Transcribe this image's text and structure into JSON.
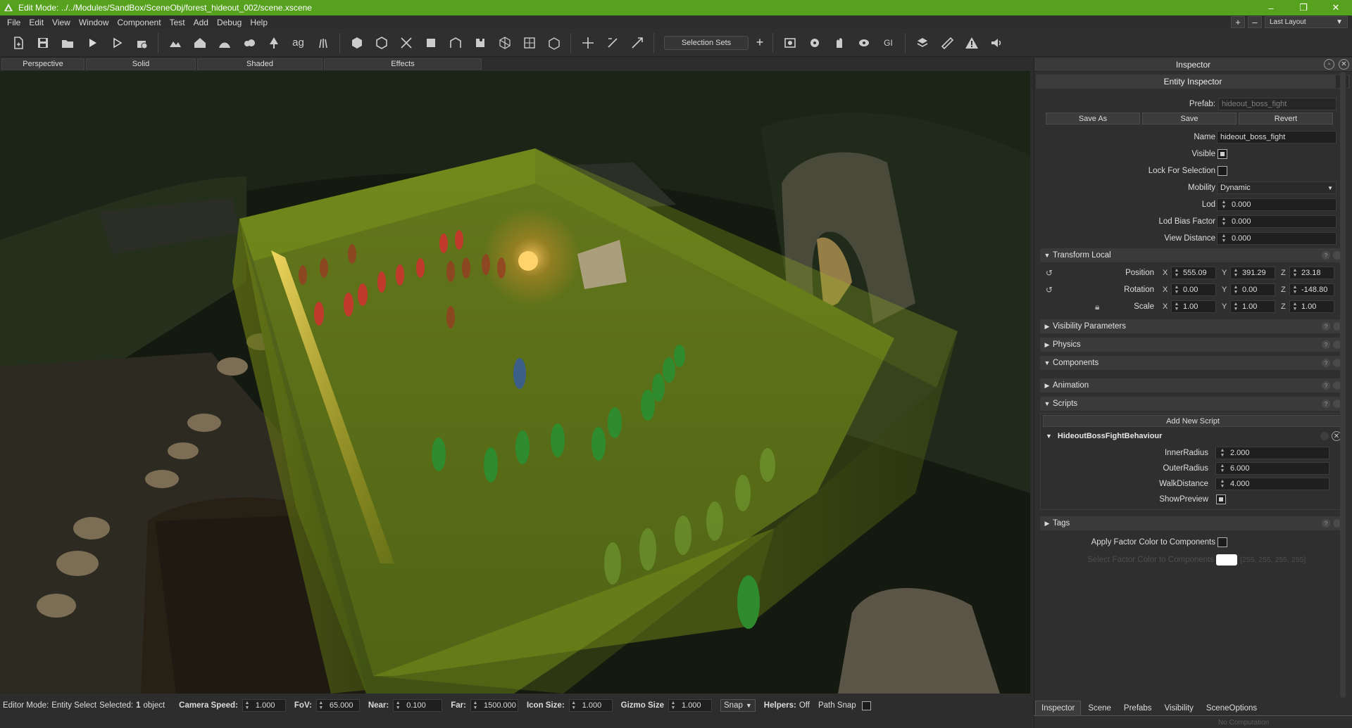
{
  "window": {
    "title": "Edit Mode: ../../Modules/SandBox/SceneObj/forest_hideout_002/scene.xscene",
    "minimize": "–",
    "maximize": "❐",
    "close": "✕"
  },
  "menu": [
    "File",
    "Edit",
    "View",
    "Window",
    "Component",
    "Test",
    "Add",
    "Debug",
    "Help"
  ],
  "layout": {
    "plus": "+",
    "minus": "–",
    "name": "Last Layout"
  },
  "toolbar": {
    "selection_sets": "Selection Sets",
    "add": "+"
  },
  "view_tabs": [
    "Perspective",
    "Solid",
    "Shaded",
    "Effects"
  ],
  "status": {
    "mode_label": "Editor Mode:",
    "mode_value": "Entity Select",
    "selected_label": "Selected:",
    "selected_count": "1",
    "selected_unit": "object",
    "camera_speed_label": "Camera Speed:",
    "camera_speed": "1.000",
    "fov_label": "FoV:",
    "fov": "65.000",
    "near_label": "Near:",
    "near": "0.100",
    "far_label": "Far:",
    "far": "1500.000",
    "icon_size_label": "Icon Size:",
    "icon_size": "1.000",
    "gizmo_size_label": "Gizmo Size",
    "gizmo_size": "1.000",
    "snap": "Snap",
    "helpers_label": "Helpers:",
    "helpers": "Off",
    "path_snap": "Path Snap"
  },
  "inspector": {
    "title": "Inspector",
    "entity_title": "Entity Inspector",
    "help": "?",
    "prefab_label": "Prefab:",
    "prefab_value": "hideout_boss_fight",
    "save_as": "Save As",
    "save": "Save",
    "revert": "Revert",
    "name_label": "Name",
    "name_value": "hideout_boss_fight",
    "visible_label": "Visible",
    "lock_label": "Lock For Selection",
    "mobility_label": "Mobility",
    "mobility_value": "Dynamic",
    "lod_label": "Lod",
    "lod_value": "0.000",
    "lod_bias_label": "Lod Bias Factor",
    "lod_bias_value": "0.000",
    "view_distance_label": "View Distance",
    "view_distance_value": "0.000",
    "transform": {
      "title": "Transform Local",
      "position_label": "Position",
      "rotation_label": "Rotation",
      "scale_label": "Scale",
      "position": [
        "555.09",
        "391.29",
        "23.18"
      ],
      "rotation": [
        "0.00",
        "0.00",
        "-148.80"
      ],
      "scale": [
        "1.00",
        "1.00",
        "1.00"
      ],
      "axes": [
        "X",
        "Y",
        "Z"
      ]
    },
    "sections": {
      "visibility": "Visibility Parameters",
      "physics": "Physics",
      "components": "Components",
      "animation": "Animation",
      "scripts": "Scripts",
      "tags": "Tags"
    },
    "add_script": "Add New Script",
    "script": {
      "name": "HideoutBossFightBehaviour",
      "inner_radius_label": "InnerRadius",
      "inner_radius": "2.000",
      "outer_radius_label": "OuterRadius",
      "outer_radius": "6.000",
      "walk_distance_label": "WalkDistance",
      "walk_distance": "4.000",
      "show_preview_label": "ShowPreview"
    },
    "apply_factor_label": "Apply Factor Color to Components",
    "select_factor_label": "Select Factor Color to Components",
    "factor_value": "[255, 255, 255, 255]"
  },
  "bottom_tabs": [
    "Inspector",
    "Scene",
    "Prefabs",
    "Visibility",
    "SceneOptions"
  ],
  "no_computation": "No Computation",
  "colors": {
    "titlebar": "#56a11e",
    "selection_volume": "#9bbf1e",
    "team_red": "#c0392b",
    "team_green": "#2e8b2e",
    "team_blue": "#3c5f8a"
  }
}
